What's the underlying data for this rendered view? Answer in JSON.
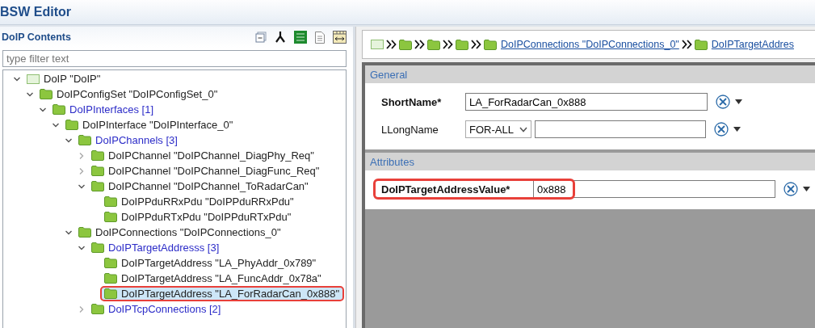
{
  "window": {
    "title": "BSW Editor"
  },
  "outline": {
    "title": "DoIP Contents",
    "filter": {
      "placeholder": "type filter text"
    },
    "tree": [
      {
        "label": "DoIP \"DoIP\"",
        "kind": "module",
        "expanded": true,
        "selected": false,
        "highlighted": false,
        "children": [
          {
            "label": "DoIPConfigSet \"DoIPConfigSet_0\"",
            "kind": "element",
            "expanded": true,
            "selected": false,
            "highlighted": false,
            "children": [
              {
                "label": "DoIPInterfaces [1]",
                "kind": "container",
                "expanded": true,
                "selected": false,
                "highlighted": false,
                "children": [
                  {
                    "label": "DoIPInterface \"DoIPInterface_0\"",
                    "kind": "element",
                    "expanded": true,
                    "selected": false,
                    "highlighted": false,
                    "children": [
                      {
                        "label": "DoIPChannels [3]",
                        "kind": "container",
                        "expanded": true,
                        "selected": false,
                        "highlighted": false,
                        "children": [
                          {
                            "label": "DoIPChannel \"DoIPChannel_DiagPhy_Req\"",
                            "kind": "element",
                            "expanded": false,
                            "selected": false,
                            "highlighted": false
                          },
                          {
                            "label": "DoIPChannel \"DoIPChannel_DiagFunc_Req\"",
                            "kind": "element",
                            "expanded": false,
                            "selected": false,
                            "highlighted": false
                          },
                          {
                            "label": "DoIPChannel \"DoIPChannel_ToRadarCan\"",
                            "kind": "element",
                            "expanded": true,
                            "selected": false,
                            "highlighted": false,
                            "children": [
                              {
                                "label": "DoIPPduRRxPdu \"DoIPPduRRxPdu\"",
                                "kind": "element",
                                "selected": false,
                                "highlighted": false
                              },
                              {
                                "label": "DoIPPduRTxPdu \"DoIPPduRTxPdu\"",
                                "kind": "element",
                                "selected": false,
                                "highlighted": false
                              }
                            ]
                          }
                        ]
                      },
                      {
                        "label": "DoIPConnections \"DoIPConnections_0\"",
                        "kind": "element",
                        "expanded": true,
                        "selected": false,
                        "highlighted": false,
                        "children": [
                          {
                            "label": "DoIPTargetAddresss [3]",
                            "kind": "container",
                            "expanded": true,
                            "selected": false,
                            "highlighted": false,
                            "children": [
                              {
                                "label": "DoIPTargetAddress \"LA_PhyAddr_0x789\"",
                                "kind": "element",
                                "selected": false,
                                "highlighted": false
                              },
                              {
                                "label": "DoIPTargetAddress \"LA_FuncAddr_0x78a\"",
                                "kind": "element",
                                "selected": false,
                                "highlighted": false
                              },
                              {
                                "label": "DoIPTargetAddress \"LA_ForRadarCan_0x888\"",
                                "kind": "element",
                                "selected": true,
                                "highlighted": true
                              }
                            ]
                          },
                          {
                            "label": "DoIPTcpConnections [2]",
                            "kind": "container",
                            "expanded": false,
                            "selected": false,
                            "highlighted": false
                          }
                        ]
                      }
                    ]
                  }
                ]
              }
            ]
          }
        ]
      }
    ]
  },
  "breadcrumb": [
    {
      "kind": "module"
    },
    {
      "kind": "folder"
    },
    {
      "kind": "folder"
    },
    {
      "kind": "folder"
    },
    {
      "kind": "link",
      "label": "DoIPConnections \"DoIPConnections_0\""
    },
    {
      "kind": "link",
      "label": "DoIPTargetAddres"
    }
  ],
  "sections": [
    {
      "title": "General",
      "fields": [
        {
          "kind": "text",
          "label": "ShortName*",
          "bold": true,
          "value": "LA_ForRadarCan_0x888",
          "highlighted": false
        },
        {
          "kind": "lang",
          "label": "LLongName",
          "bold": false,
          "select": "FOR-ALL",
          "highlighted": false
        }
      ]
    },
    {
      "title": "Attributes",
      "fields": [
        {
          "kind": "text",
          "label": "DoIPTargetAddressValue*",
          "bold": true,
          "value": "0x888",
          "highlighted": true
        }
      ]
    }
  ]
}
